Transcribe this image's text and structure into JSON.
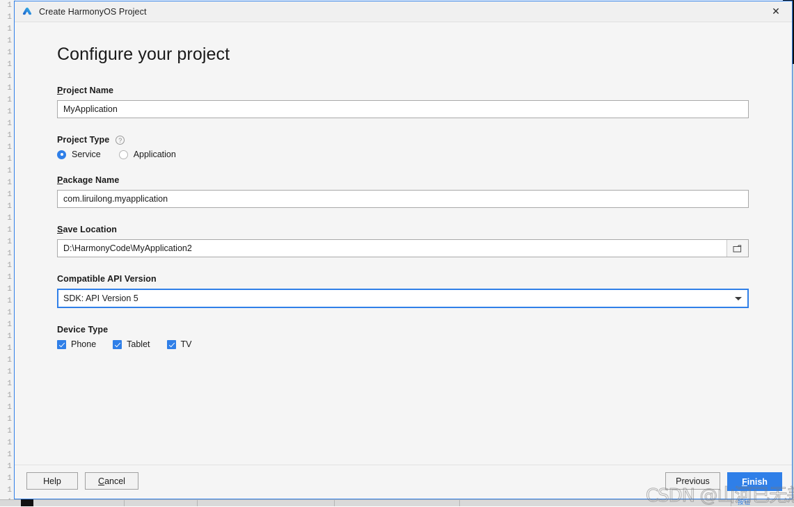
{
  "window": {
    "title": "Create HarmonyOS Project",
    "app_icon": "harmonyos-logo-icon",
    "close_label": "✕"
  },
  "page": {
    "heading": "Configure your project"
  },
  "fields": {
    "project_name": {
      "label_mnemonic": "P",
      "label_rest": "roject Name",
      "value": "MyApplication"
    },
    "project_type": {
      "label": "Project Type",
      "help_icon_glyph": "?",
      "options": [
        {
          "label": "Service",
          "selected": true
        },
        {
          "label": "Application",
          "selected": false
        }
      ]
    },
    "package_name": {
      "label_mnemonic": "P",
      "label_rest": "ackage Name",
      "value": "com.liruilong.myapplication"
    },
    "save_location": {
      "label_mnemonic": "S",
      "label_rest": "ave Location",
      "value": "D:\\HarmonyCode\\MyApplication2",
      "browse_icon": "folder-icon"
    },
    "api_version": {
      "label": "Compatible API Version",
      "value": "SDK: API Version 5",
      "arrow_icon": "chevron-down-icon"
    },
    "device_type": {
      "label": "Device Type",
      "options": [
        {
          "label": "Phone",
          "checked": true
        },
        {
          "label": "Tablet",
          "checked": true
        },
        {
          "label": "TV",
          "checked": true
        }
      ]
    }
  },
  "footer": {
    "help": "Help",
    "cancel_mnemonic": "C",
    "cancel_rest": "ancel",
    "previous": "Previous",
    "finish_mnemonic": "F",
    "finish_rest": "inish"
  },
  "watermark": {
    "text": "CSDN @山河已无恙"
  },
  "background": {
    "gutter_line_number": "1",
    "status_text": "按钮"
  },
  "colors": {
    "accent": "#2f7fe8",
    "dialog_bg": "#f5f5f5",
    "input_bg": "#ffffff",
    "text": "#1a1a1a"
  }
}
